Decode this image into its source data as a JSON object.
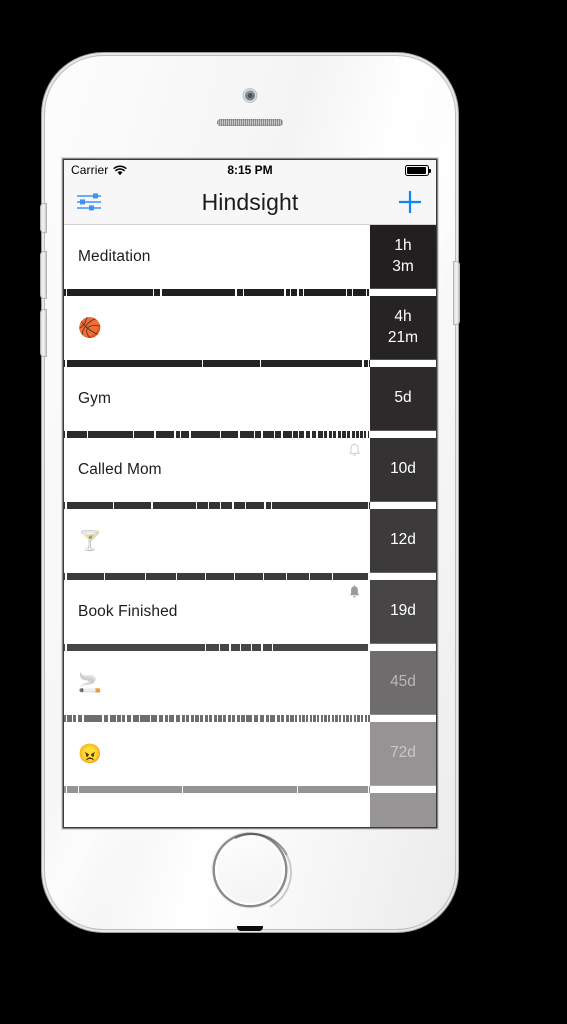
{
  "status_bar": {
    "carrier": "Carrier",
    "time": "8:15 PM",
    "wifi_icon": "wifi-icon",
    "battery_icon": "battery-icon",
    "battery_level": 95
  },
  "nav_bar": {
    "title": "Hindsight",
    "left_icon": "sliders-icon",
    "right_icon": "plus-icon",
    "accent_color": "#007aff"
  },
  "entries": [
    {
      "label": "Meditation",
      "emoji": "",
      "badge": "1h\n3m",
      "badge_lines": [
        "1h",
        "3m"
      ],
      "badge_color": "#211f1f",
      "strip_color": "#211f1f",
      "text_color": "#ffffff",
      "bell": "none",
      "ticks": [
        0.5,
        29.0,
        31.5,
        56.0,
        58.5,
        72.0,
        73.8,
        76.2,
        78.0,
        92.0,
        94.0,
        98.6,
        99.6
      ]
    },
    {
      "label": "",
      "emoji": "🏀",
      "badge": "4h\n21m",
      "badge_lines": [
        "4h",
        "21m"
      ],
      "badge_color": "#252323",
      "strip_color": "#252323",
      "text_color": "#ffffff",
      "bell": "none",
      "ticks": [
        0.4,
        45.0,
        64.0,
        97.5,
        99.2
      ]
    },
    {
      "label": "Gym",
      "emoji": "",
      "badge": "5d",
      "badge_lines": [
        "5d"
      ],
      "badge_color": "#2c2a2a",
      "strip_color": "#2c2a2a",
      "text_color": "#ffffff",
      "bell": "none",
      "ticks": [
        0.4,
        7.5,
        22.5,
        29.5,
        36.0,
        37.8,
        41.0,
        51.0,
        57.0,
        62.0,
        64.5,
        68.5,
        71.0,
        74.5,
        76.5,
        78.5,
        80.5,
        82.5,
        84.5,
        86.0,
        87.5,
        89.0,
        90.5,
        92.0,
        93.5,
        95.0,
        96.3,
        97.6,
        98.8,
        99.6
      ]
    },
    {
      "label": "Called Mom",
      "emoji": "",
      "badge": "10d",
      "badge_lines": [
        "10d"
      ],
      "badge_color": "#343232",
      "strip_color": "#343232",
      "text_color": "#ffffff",
      "bell": "outline",
      "ticks": [
        0.4,
        16.0,
        28.5,
        43.0,
        47.0,
        51.0,
        55.0,
        59.0,
        65.5,
        67.5,
        99.2
      ]
    },
    {
      "label": "",
      "emoji": "🍸",
      "badge": "12d",
      "badge_lines": [
        "12d"
      ],
      "badge_color": "#3c3a3a",
      "strip_color": "#3c3a3a",
      "text_color": "#ffffff",
      "bell": "none",
      "ticks": [
        0.4,
        13.0,
        26.5,
        36.5,
        46.0,
        55.5,
        65.0,
        72.5,
        80.0,
        87.5,
        99.4
      ]
    },
    {
      "label": "Book Finished",
      "emoji": "",
      "badge": "19d",
      "badge_lines": [
        "19d"
      ],
      "badge_color": "#474545",
      "strip_color": "#474545",
      "text_color": "#ffffff",
      "bell": "filled",
      "ticks": [
        0.4,
        46.0,
        50.5,
        54.0,
        57.5,
        61.0,
        64.5,
        68.0,
        99.4
      ]
    },
    {
      "label": "",
      "emoji": "🚬",
      "badge": "45d",
      "badge_lines": [
        "45d"
      ],
      "badge_color": "#6e6c6c",
      "strip_color": "#6e6c6c",
      "text_color": "#b9b7b7",
      "bell": "none",
      "ticks": [
        0.5,
        2.5,
        4.0,
        6.0,
        12.5,
        14.5,
        17.0,
        18.5,
        20.0,
        22.0,
        24.5,
        28.0,
        30.5,
        32.5,
        34.0,
        36.0,
        38.0,
        39.5,
        41.0,
        42.5,
        44.0,
        45.5,
        47.0,
        48.5,
        50.0,
        51.5,
        53.0,
        54.5,
        56.0,
        57.5,
        59.0,
        61.5,
        63.5,
        65.5,
        67.0,
        69.0,
        70.5,
        72.0,
        73.5,
        75.0,
        76.2,
        77.4,
        78.6,
        79.8,
        81.0,
        82.2,
        83.4,
        84.6,
        85.8,
        87.0,
        88.2,
        89.4,
        90.6,
        91.8,
        93.0,
        94.2,
        95.4,
        96.6,
        97.8,
        99.0
      ]
    },
    {
      "label": "",
      "emoji": "😠",
      "badge": "72d",
      "badge_lines": [
        "72d"
      ],
      "badge_color": "#959393",
      "strip_color": "#959393",
      "text_color": "#c9c7c7",
      "bell": "none",
      "ticks": [
        0.5,
        4.5,
        38.5,
        76.0,
        99.2
      ]
    },
    {
      "label": "",
      "emoji": "",
      "badge": "",
      "badge_lines": [],
      "badge_color": "#979595",
      "strip_color": "#979595",
      "text_color": "#cccaca",
      "bell": "none",
      "ticks": []
    }
  ]
}
